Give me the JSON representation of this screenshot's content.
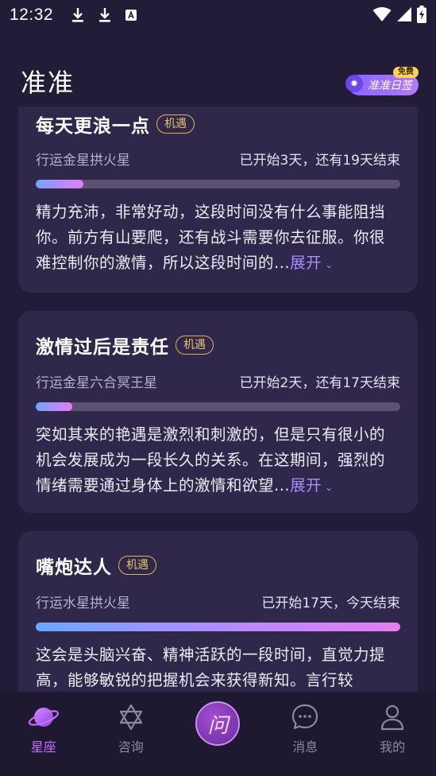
{
  "status_bar": {
    "time": "12:32"
  },
  "header": {
    "title": "准准",
    "daily_sign": {
      "label": "准准日签",
      "badge": "免费"
    }
  },
  "cards": [
    {
      "title": "每天更浪一点",
      "tag": "机遇",
      "transit": "行运金星拱火星",
      "status": "已开始3天，还有19天结束",
      "progress_fraction": 0.13,
      "description": "精力充沛，非常好动，这段时间没有什么事能阻挡你。前方有山要爬，还有战斗需要你去征服。你很难控制你的激情，所以这段时间的...",
      "expand_label": "展开"
    },
    {
      "title": "激情过后是责任",
      "tag": "机遇",
      "transit": "行运金星六合冥王星",
      "status": "已开始2天，还有17天结束",
      "progress_fraction": 0.1,
      "description": "突如其来的艳遇是激烈和刺激的，但是只有很小的机会发展成为一段长久的关系。在这期间，强烈的情绪需要通过身体上的激情和欲望...",
      "expand_label": "展开"
    },
    {
      "title": "嘴炮达人",
      "tag": "机遇",
      "transit": "行运水星拱火星",
      "status": "已开始17天，今天结束",
      "progress_fraction": 1.0,
      "description": "这会是头脑兴奋、精神活跃的一段时间，直觉力提高，能够敏锐的把握机会来获得新知。言行较",
      "expand_label": ""
    }
  ],
  "bottom_nav": {
    "items": [
      {
        "label": "星座",
        "icon": "planet-icon",
        "active": true
      },
      {
        "label": "咨询",
        "icon": "star-of-david-icon",
        "active": false
      },
      {
        "label": "问",
        "icon": "ask-button-icon",
        "active": false
      },
      {
        "label": "消息",
        "icon": "chat-bubble-icon",
        "active": false
      },
      {
        "label": "我的",
        "icon": "user-icon",
        "active": false
      }
    ]
  },
  "colors": {
    "background": "#231c38",
    "card": "#30284a",
    "accent": "#c06fff",
    "tag": "#e0b35a"
  }
}
